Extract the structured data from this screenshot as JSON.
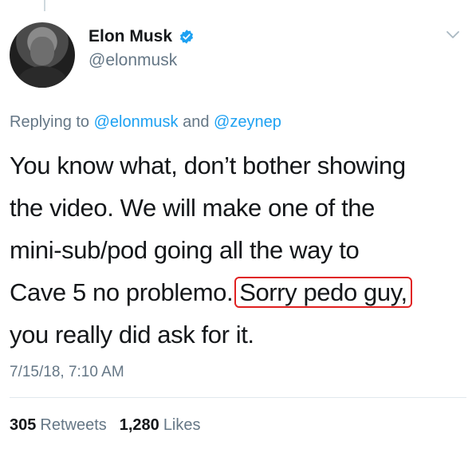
{
  "tweet": {
    "author": {
      "display_name": "Elon Musk",
      "handle": "@elonmusk",
      "verified": true
    },
    "reply_context": {
      "prefix": "Replying to",
      "mention1": "@elonmusk",
      "conjunction": "and",
      "mention2": "@zeynep"
    },
    "text_lines": {
      "line1": "You know what, don’t bother showing",
      "line2": "the video. We will make one of the",
      "line3": "mini-sub/pod going all the way to",
      "line4_pre": "Cave 5 no problemo.",
      "line4_highlight": "Sorry pedo guy,",
      "line5": "you really did ask for it."
    },
    "timestamp": "7/15/18, 7:10 AM",
    "stats": {
      "retweets_count": "305",
      "retweets_label": "Retweets",
      "likes_count": "1,280",
      "likes_label": "Likes"
    }
  },
  "colors": {
    "accent": "#1da1f2",
    "secondary_text": "#657786",
    "highlight_border": "#e02020"
  },
  "icons": {
    "verified": "verified-badge-icon",
    "menu": "chevron-down-icon"
  }
}
